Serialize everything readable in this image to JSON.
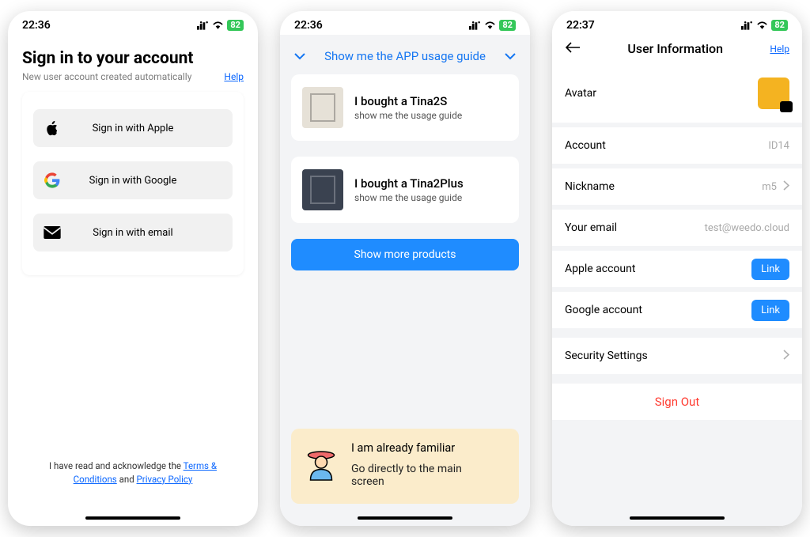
{
  "phone1": {
    "time": "22:36",
    "battery": "82",
    "title": "Sign in to your account",
    "subtitle": "New user account created automatically",
    "help": "Help",
    "buttons": {
      "apple": "Sign in with Apple",
      "google": "Sign in with Google",
      "email": "Sign in with email"
    },
    "terms_prefix": "I have read and acknowledge the ",
    "terms_link": "Terms & Conditions",
    "terms_mid": " and ",
    "privacy_link": "Privacy Policy"
  },
  "phone2": {
    "time": "22:36",
    "battery": "82",
    "header": "Show me the APP usage guide",
    "products": [
      {
        "title": "I bought a Tina2S",
        "sub": "show me the usage guide"
      },
      {
        "title": "I bought a Tina2Plus",
        "sub": "show me the usage guide"
      }
    ],
    "show_more": "Show more products",
    "familiar_line1": "I am already familiar",
    "familiar_line2": "Go directly to the main screen"
  },
  "phone3": {
    "time": "22:37",
    "battery": "82",
    "title": "User Information",
    "help": "Help",
    "rows": {
      "avatar": "Avatar",
      "account": {
        "label": "Account",
        "value": "ID14"
      },
      "nickname": {
        "label": "Nickname",
        "value": "m5"
      },
      "email": {
        "label": "Your email",
        "value": "test@weedo.cloud"
      },
      "apple": {
        "label": "Apple account",
        "action": "Link"
      },
      "google": {
        "label": "Google account",
        "action": "Link"
      },
      "security": "Security Settings"
    },
    "signout": "Sign Out"
  }
}
